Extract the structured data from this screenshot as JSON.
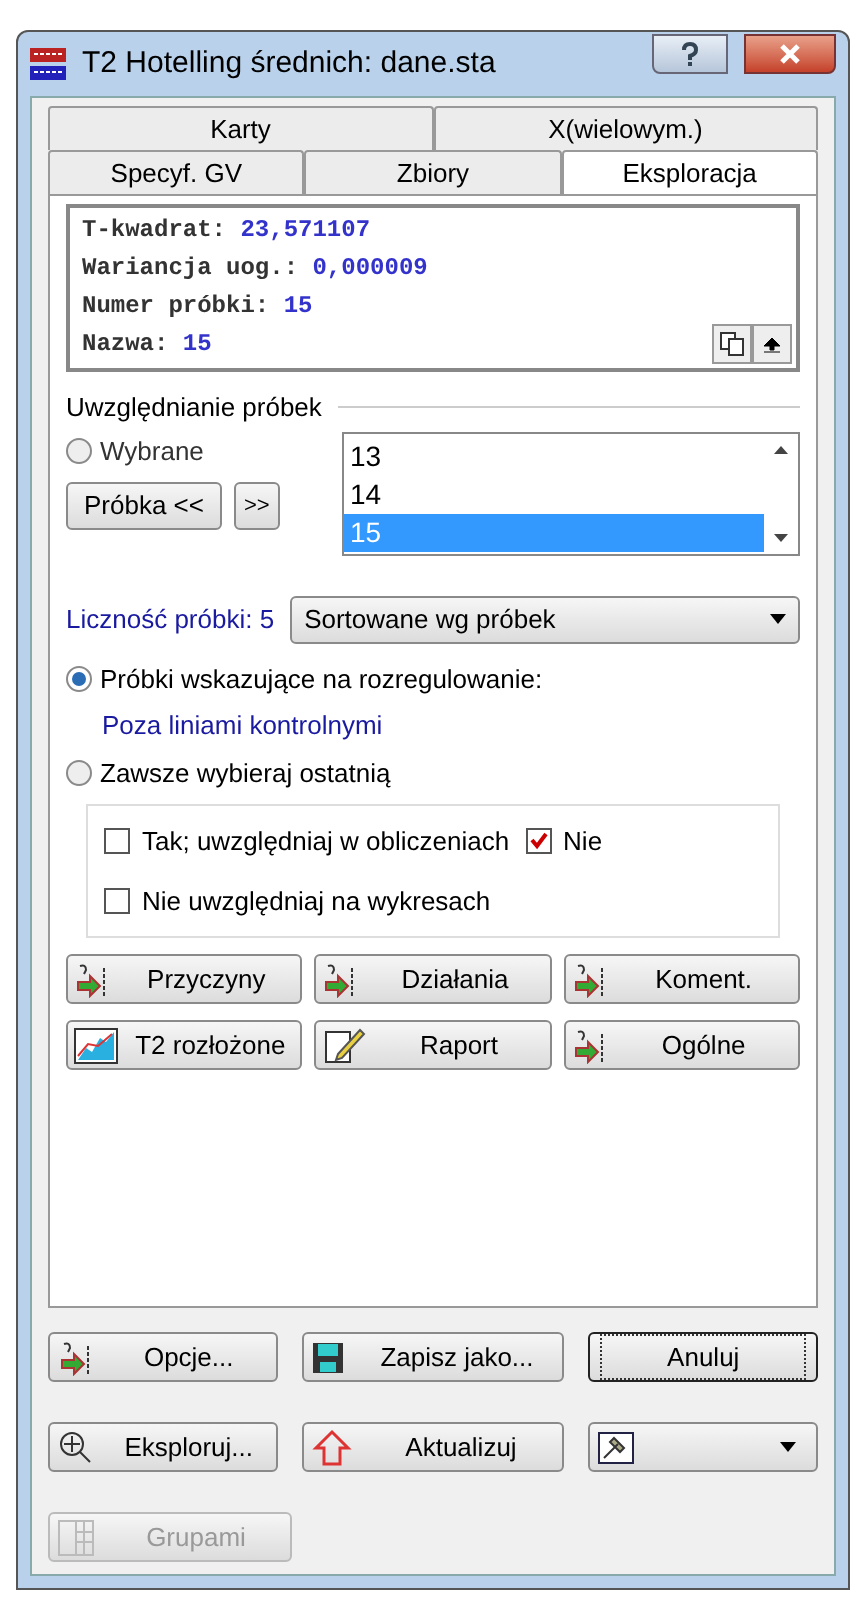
{
  "window": {
    "title": "T2 Hotelling średnich: dane.sta"
  },
  "tab_rows": [
    [
      {
        "label": "Karty",
        "selected": false
      },
      {
        "label": "X(wielowym.)",
        "selected": false
      }
    ],
    [
      {
        "label": "Specyf. GV",
        "selected": false
      },
      {
        "label": "Zbiory",
        "selected": false
      },
      {
        "label": "Eksploracja",
        "selected": true
      }
    ]
  ],
  "info": [
    {
      "label": "T-kwadrat:",
      "value": "23,571107"
    },
    {
      "label": "Wariancja uog.:",
      "value": "0,000009"
    },
    {
      "label": "Numer próbki:",
      "value": "15"
    },
    {
      "label": "Nazwa:",
      "value": "15"
    }
  ],
  "samples": {
    "title": "Uwzględnianie próbek",
    "selected_radio": {
      "label": "Wybrane",
      "selected": false
    },
    "prev_button": "Próbka <<",
    "next_button": ">>",
    "list": [
      {
        "label": "13",
        "selected": false
      },
      {
        "label": "14",
        "selected": false
      },
      {
        "label": "15",
        "selected": true
      }
    ],
    "count": "Liczność próbki: 5",
    "sort_select": "Sortowane wg próbek",
    "radios": [
      {
        "label": "Próbki wskazujące na rozregulowanie:",
        "selected": true,
        "note": "Poza liniami kontrolnymi"
      },
      {
        "label": "Zawsze wybieraj ostatnią",
        "selected": false
      }
    ],
    "checks": [
      {
        "label": "Tak; uwzględniaj w obliczeniach",
        "checked": false
      },
      {
        "label": "Nie",
        "checked": true
      },
      {
        "label": "Nie uwzględniaj na wykresach",
        "checked": false
      }
    ]
  },
  "action_rows": [
    [
      {
        "label": "Przyczyny",
        "kind": "note"
      },
      {
        "label": "Działania",
        "kind": "note"
      },
      {
        "label": "Koment.",
        "kind": "note"
      }
    ],
    [
      {
        "label": "T2 rozłożone",
        "kind": "chart"
      },
      {
        "label": "Raport",
        "kind": "report"
      },
      {
        "label": "Ogólne",
        "kind": "note"
      }
    ]
  ],
  "bottom_rows": [
    [
      {
        "label": "Opcje...",
        "kind": "note",
        "disabled": false,
        "focused": false
      },
      {
        "label": "Zapisz jako...",
        "kind": "save",
        "disabled": false,
        "focused": false
      },
      {
        "label": "Anuluj",
        "kind": "plain",
        "disabled": false,
        "focused": true
      }
    ],
    [
      {
        "label": "Eksploruj...",
        "kind": "explore",
        "disabled": false,
        "focused": false
      },
      {
        "label": "Aktualizuj",
        "kind": "home",
        "disabled": false,
        "focused": false
      },
      {
        "kind": "tools",
        "disabled": false,
        "focused": false
      }
    ],
    [
      {
        "label": "Grupami",
        "kind": "grid",
        "disabled": true,
        "focused": false
      }
    ]
  ]
}
